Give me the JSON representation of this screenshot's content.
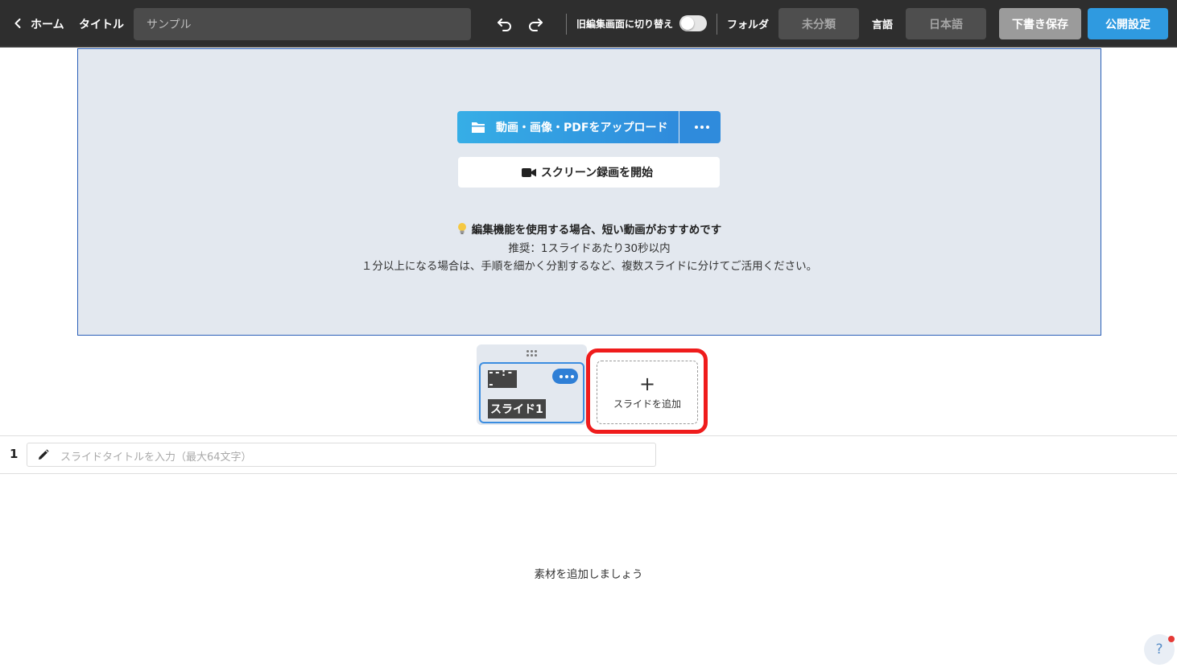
{
  "header": {
    "back_label": "ホーム",
    "title_label": "タイトル",
    "title_value": "サンプル",
    "switch_label": "旧編集画面に切り替え",
    "folder_label": "フォルダ",
    "folder_value": "未分類",
    "language_label": "言語",
    "language_value": "日本語",
    "save_draft_label": "下書き保存",
    "publish_label": "公開設定",
    "legacy_editor_enabled": false
  },
  "upload": {
    "upload_button_label": "動画・画像・PDFをアップロード",
    "record_button_label": "スクリーン録画を開始",
    "tip_heading": "編集機能を使用する場合、短い動画がおすすめです",
    "tip_line_1": "推奨：1スライドあたり30秒以内",
    "tip_line_2": "１分以上になる場合は、手順を細かく分割するなど、複数スライドに分けてご活用ください。"
  },
  "slides": {
    "items": [
      {
        "duration": "--:--",
        "name": "スライド1"
      }
    ],
    "add_slide_label": "スライドを追加"
  },
  "editor": {
    "slide_index": "1",
    "title_placeholder": "スライドタイトルを入力（最大64文字）",
    "empty_message": "素材を追加しましょう"
  },
  "help": {
    "label": "?"
  },
  "colors": {
    "topbar": "#2e2e2e",
    "accent": "#2f9ae0",
    "upload_area": "#e3e8ef",
    "highlight": "#ef1c1c"
  }
}
